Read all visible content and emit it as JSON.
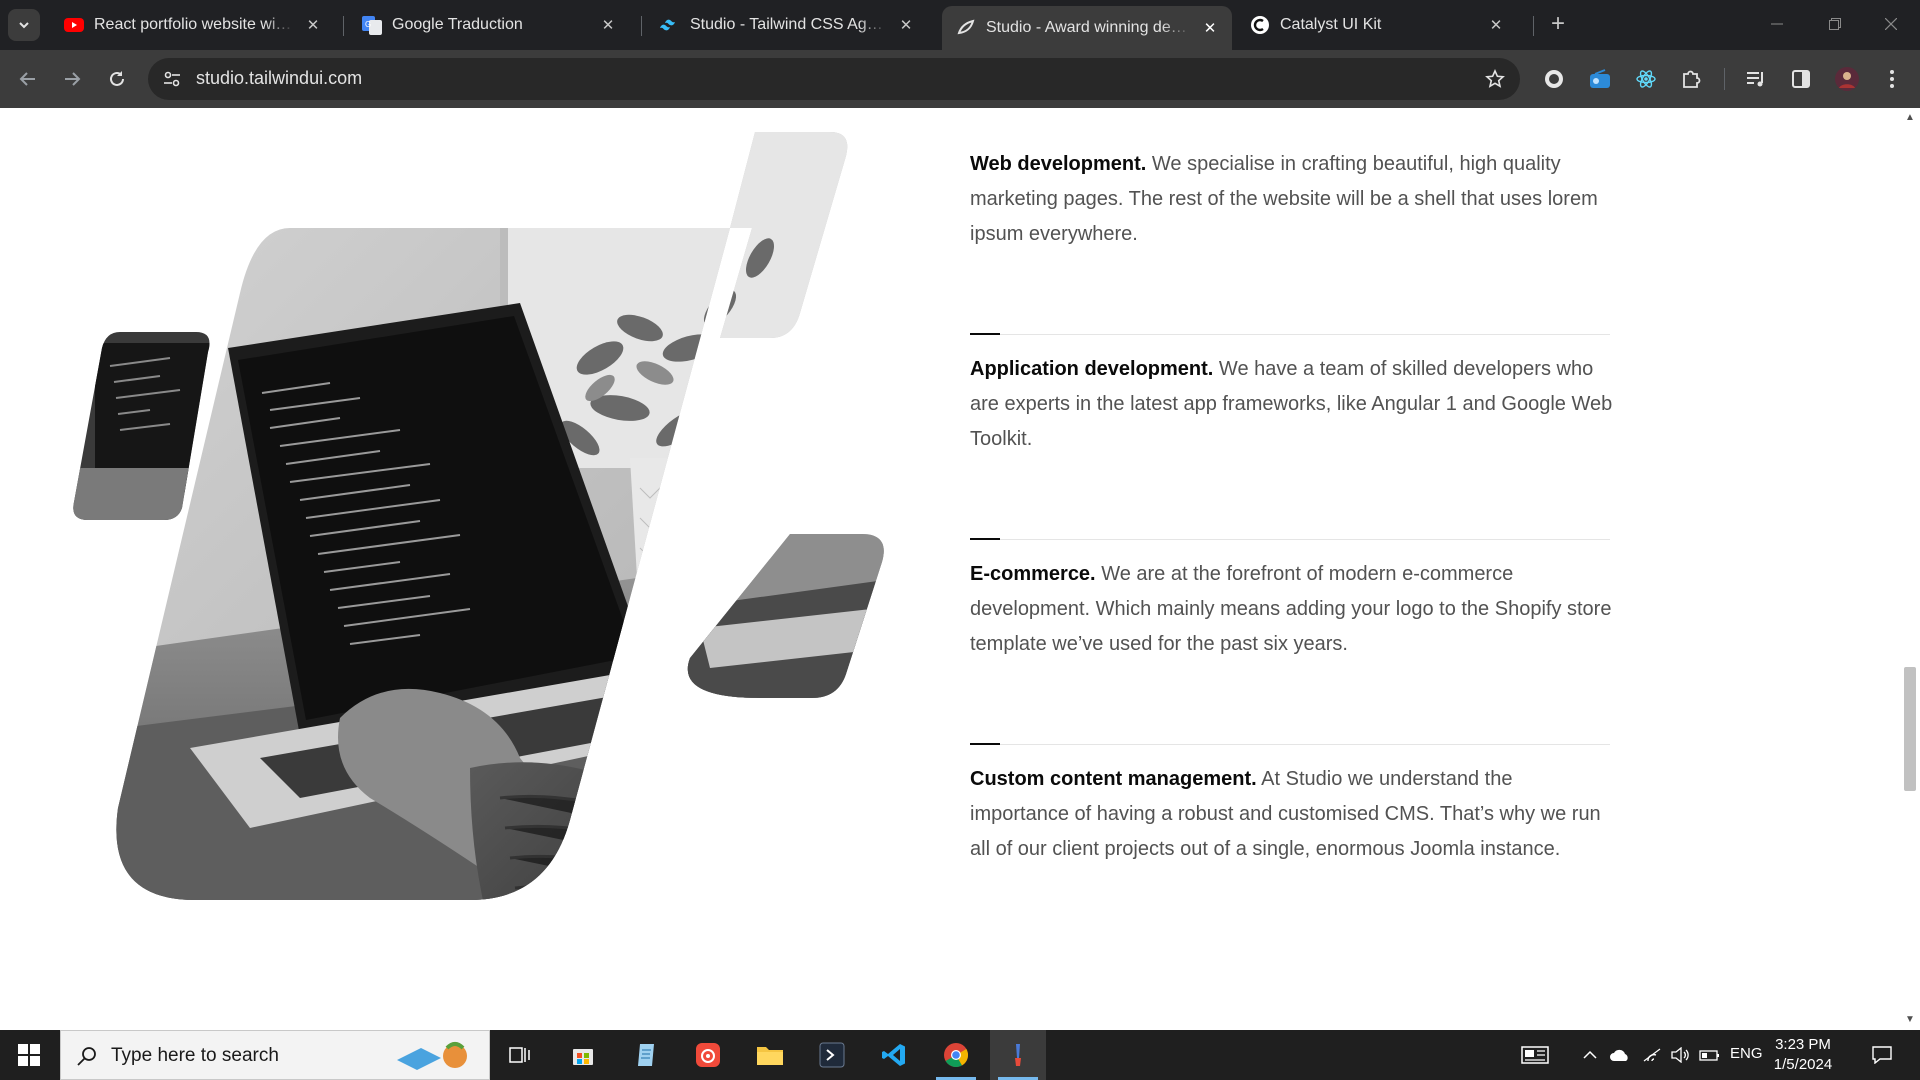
{
  "browser": {
    "tabs": [
      {
        "title": "React portfolio website with ani",
        "favicon": "youtube-icon",
        "active": false
      },
      {
        "title": "Google Traduction",
        "favicon": "google-translate-icon",
        "active": false
      },
      {
        "title": "Studio - Tailwind CSS Agency Te",
        "favicon": "tailwind-icon",
        "active": false
      },
      {
        "title": "Studio - Award winning develop",
        "favicon": "studio-icon",
        "active": true
      },
      {
        "title": "Catalyst UI Kit",
        "favicon": "catalyst-icon",
        "active": false
      }
    ],
    "url": "studio.tailwindui.com"
  },
  "services": [
    {
      "title": "Web development.",
      "body": "We specialise in crafting beautiful, high quality marketing pages. The rest of the website will be a shell that uses lorem ipsum everywhere."
    },
    {
      "title": "Application development.",
      "body": "We have a team of skilled developers who are experts in the latest app frameworks, like Angular 1 and Google Web Toolkit."
    },
    {
      "title": "E-commerce.",
      "body": "We are at the forefront of modern e-commerce development. Which mainly means adding your logo to the Shopify store template we’ve used for the past six years."
    },
    {
      "title": "Custom content management.",
      "body": "At Studio we understand the importance of having a robust and customised CMS. That’s why we run all of our client projects out of a single, enormous Joomla instance."
    }
  ],
  "taskbar": {
    "search_placeholder": "Type here to search",
    "language": "ENG",
    "time": "3:23 PM",
    "date": "1/5/2024"
  },
  "colors": {
    "tab_strip": "#202124",
    "toolbar": "#3c3c3c",
    "heading": "#0a0a0a",
    "body_text": "#525252",
    "divider": "#e5e5e5"
  }
}
